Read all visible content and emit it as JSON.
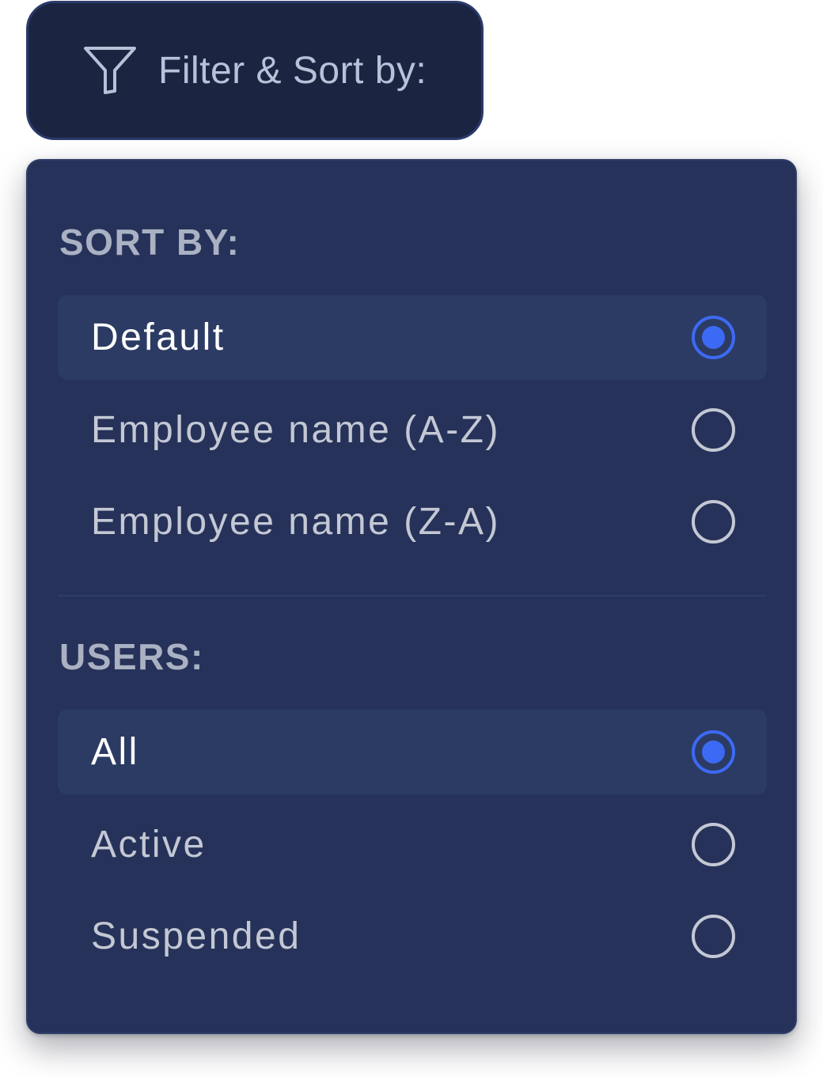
{
  "filter_button": {
    "label": "Filter & Sort by:",
    "icon": "filter-funnel-icon"
  },
  "sort_section": {
    "heading": "SORT BY:",
    "options": [
      {
        "label": "Default",
        "selected": true
      },
      {
        "label": "Employee name (A-Z)",
        "selected": false
      },
      {
        "label": "Employee name (Z-A)",
        "selected": false
      }
    ]
  },
  "users_section": {
    "heading": "USERS:",
    "options": [
      {
        "label": "All",
        "selected": true
      },
      {
        "label": "Active",
        "selected": false
      },
      {
        "label": "Suspended",
        "selected": false
      }
    ]
  },
  "colors": {
    "button_bg": "#1b2441",
    "panel_bg": "#263259",
    "selected_row_bg": "#2c3b63",
    "accent": "#3d6af5",
    "heading_text": "#aab1c3",
    "option_text": "#c3c8d4"
  }
}
